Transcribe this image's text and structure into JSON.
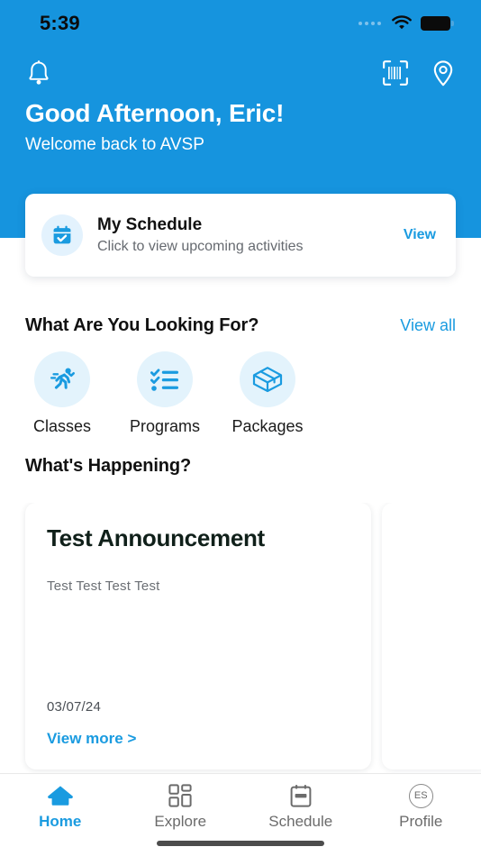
{
  "status_bar": {
    "time": "5:39",
    "signal_icon": "signal-dots-icon",
    "wifi_icon": "wifi-icon",
    "battery_icon": "battery-full-icon"
  },
  "header": {
    "notifications_icon": "bell-icon",
    "scan_icon": "barcode-scanner-icon",
    "location_icon": "map-pin-icon",
    "greeting": "Good Afternoon, Eric!",
    "subtitle": "Welcome back to AVSP",
    "brand_color": "#1694DE"
  },
  "schedule_card": {
    "icon": "calendar-check-icon",
    "title": "My Schedule",
    "subtitle": "Click to view upcoming activities",
    "action_label": "View",
    "accent_color": "#1A9BE0"
  },
  "looking_for": {
    "title": "What Are You Looking For?",
    "view_all_label": "View all",
    "categories": [
      {
        "label": "Classes",
        "icon": "running-person-icon"
      },
      {
        "label": "Programs",
        "icon": "checklist-icon"
      },
      {
        "label": "Packages",
        "icon": "package-box-icon"
      }
    ]
  },
  "happening": {
    "title": "What's Happening?",
    "announcement": {
      "title": "Test Announcement",
      "body": "Test Test Test Test",
      "date": "03/07/24",
      "more_label": "View more >"
    }
  },
  "bottom_nav": {
    "items": [
      {
        "label": "Home",
        "icon": "home-icon",
        "active": true
      },
      {
        "label": "Explore",
        "icon": "grid-icon",
        "active": false
      },
      {
        "label": "Schedule",
        "icon": "calendar-icon",
        "active": false
      },
      {
        "label": "Profile",
        "icon": "avatar-icon",
        "active": false,
        "initials": "ES"
      }
    ]
  }
}
